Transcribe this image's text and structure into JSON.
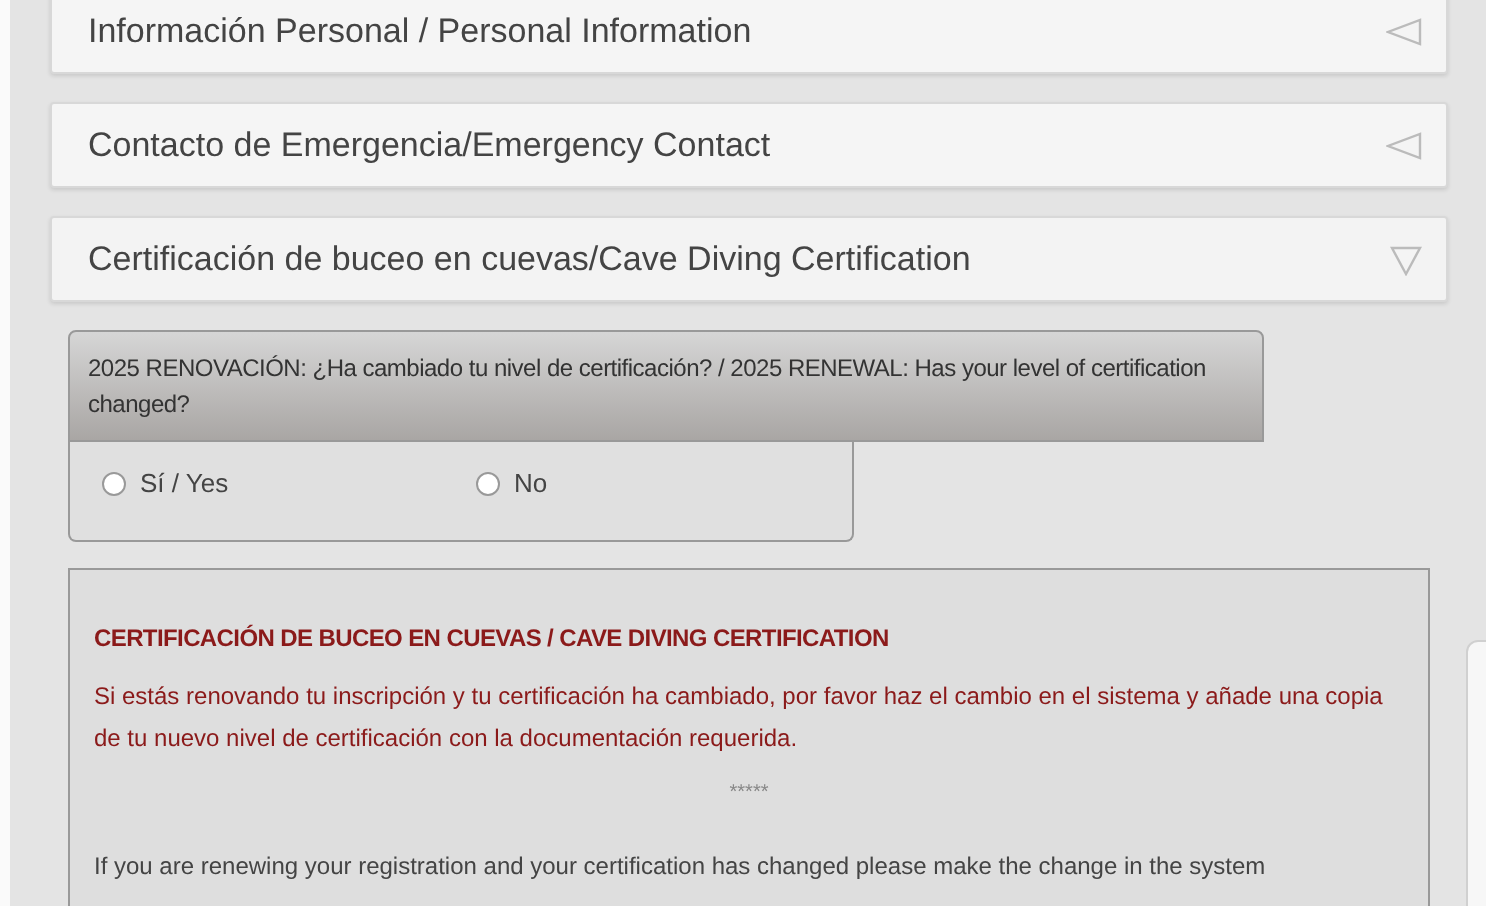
{
  "sections": [
    {
      "title": "Información Personal / Personal Information",
      "expanded": false
    },
    {
      "title": "Contacto de Emergencia/Emergency Contact",
      "expanded": false
    },
    {
      "title": "Certificación de buceo en cuevas/Cave Diving Certification",
      "expanded": true
    }
  ],
  "question": {
    "label": "2025 RENOVACIÓN: ¿Ha cambiado tu nivel de certificación? / 2025 RENEWAL: Has your level of certification changed?",
    "options": [
      {
        "label": "Sí / Yes",
        "selected": false
      },
      {
        "label": "No",
        "selected": false
      }
    ]
  },
  "notice": {
    "heading": "CERTIFICACIÓN DE BUCEO EN CUEVAS / CAVE DIVING CERTIFICATION",
    "spanish": "Si estás renovando tu inscripción y tu certificación ha cambiado, por favor haz el cambio en el sistema y añade una copia de tu nuevo nivel de certificación con la documentación requerida.",
    "separator": "*****",
    "english": "If you are renewing your registration and your certification has changed please make the change in the system"
  }
}
